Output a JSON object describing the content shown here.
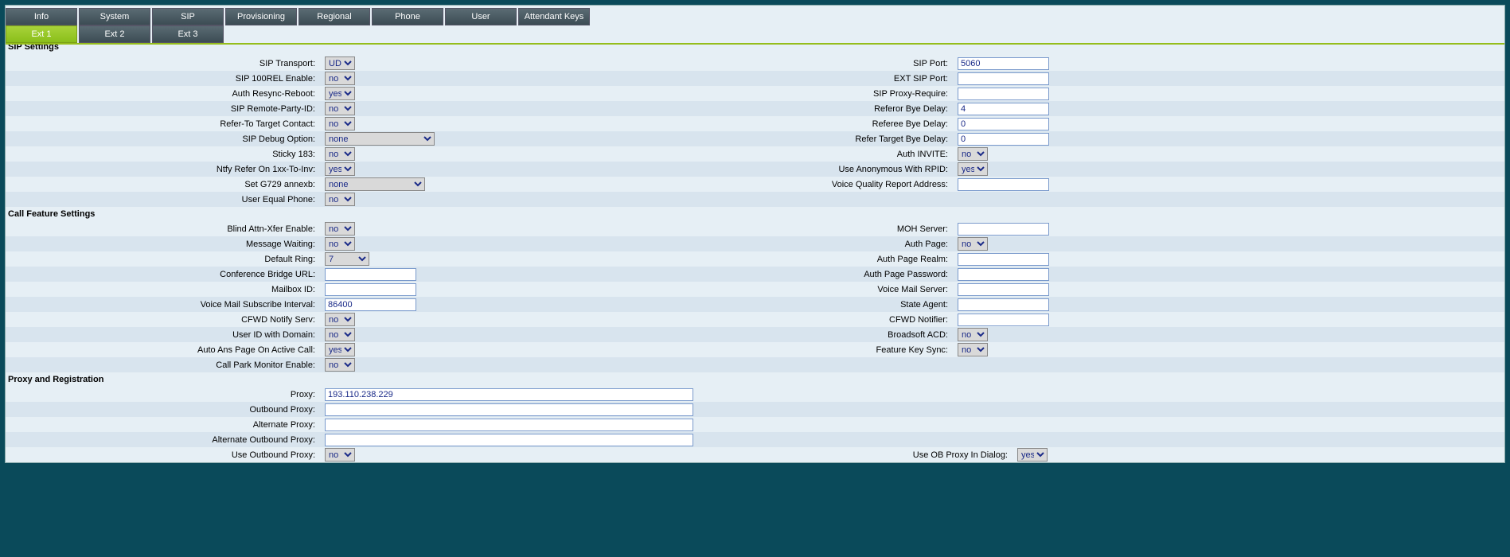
{
  "topTabs": [
    "Info",
    "System",
    "SIP",
    "Provisioning",
    "Regional",
    "Phone",
    "User",
    "Attendant Keys"
  ],
  "subTabs": [
    "Ext 1",
    "Ext 2",
    "Ext 3"
  ],
  "subActive": 0,
  "sections": {
    "sip": {
      "title": "SIP Settings",
      "rows": [
        {
          "l": "SIP Transport:",
          "t": "select",
          "v": "UDP",
          "w": "narrow",
          "r": "SIP Port:",
          "rt": "text",
          "rv": "5060"
        },
        {
          "l": "SIP 100REL Enable:",
          "t": "select",
          "v": "no",
          "w": "narrow",
          "r": "EXT SIP Port:",
          "rt": "text",
          "rv": ""
        },
        {
          "l": "Auth Resync-Reboot:",
          "t": "select",
          "v": "yes",
          "w": "narrow",
          "r": "SIP Proxy-Require:",
          "rt": "text",
          "rv": ""
        },
        {
          "l": "SIP Remote-Party-ID:",
          "t": "select",
          "v": "no",
          "w": "narrow",
          "r": "Referor Bye Delay:",
          "rt": "text",
          "rv": "4"
        },
        {
          "l": "Refer-To Target Contact:",
          "t": "select",
          "v": "no",
          "w": "narrow",
          "r": "Referee Bye Delay:",
          "rt": "text",
          "rv": "0"
        },
        {
          "l": "SIP Debug Option:",
          "t": "select",
          "v": "none",
          "w": "wide",
          "r": "Refer Target Bye Delay:",
          "rt": "text",
          "rv": "0"
        },
        {
          "l": "Sticky 183:",
          "t": "select",
          "v": "no",
          "w": "narrow",
          "r": "Auth INVITE:",
          "rt": "select",
          "rv": "no",
          "rw": "narrow"
        },
        {
          "l": "Ntfy Refer On 1xx-To-Inv:",
          "t": "select",
          "v": "yes",
          "w": "narrow",
          "r": "Use Anonymous With RPID:",
          "rt": "select",
          "rv": "yes",
          "rw": "narrow"
        },
        {
          "l": "Set G729 annexb:",
          "t": "select",
          "v": "none",
          "w": "wider",
          "r": "Voice Quality Report Address:",
          "rt": "text",
          "rv": ""
        },
        {
          "l": "User Equal Phone:",
          "t": "select",
          "v": "no",
          "w": "narrow"
        }
      ]
    },
    "cfs": {
      "title": "Call Feature Settings",
      "rows": [
        {
          "l": "Blind Attn-Xfer Enable:",
          "t": "select",
          "v": "no",
          "w": "narrow",
          "r": "MOH Server:",
          "rt": "text",
          "rv": ""
        },
        {
          "l": "Message Waiting:",
          "t": "select",
          "v": "no",
          "w": "narrow",
          "r": "Auth Page:",
          "rt": "select",
          "rv": "no",
          "rw": "narrow"
        },
        {
          "l": "Default Ring:",
          "t": "select",
          "v": "7",
          "w": "med",
          "r": "Auth Page Realm:",
          "rt": "text",
          "rv": ""
        },
        {
          "l": "Conference Bridge URL:",
          "t": "text",
          "v": "",
          "r": "Auth Page Password:",
          "rt": "text",
          "rv": ""
        },
        {
          "l": "Mailbox ID:",
          "t": "text",
          "v": "",
          "r": "Voice Mail Server:",
          "rt": "text",
          "rv": ""
        },
        {
          "l": "Voice Mail Subscribe Interval:",
          "t": "text",
          "v": "86400",
          "r": "State Agent:",
          "rt": "text",
          "rv": ""
        },
        {
          "l": "CFWD Notify Serv:",
          "t": "select",
          "v": "no",
          "w": "narrow",
          "r": "CFWD Notifier:",
          "rt": "text",
          "rv": ""
        },
        {
          "l": "User ID with Domain:",
          "t": "select",
          "v": "no",
          "w": "narrow",
          "r": "Broadsoft ACD:",
          "rt": "select",
          "rv": "no",
          "rw": "narrow"
        },
        {
          "l": "Auto Ans Page On Active Call:",
          "t": "select",
          "v": "yes",
          "w": "narrow",
          "r": "Feature Key Sync:",
          "rt": "select",
          "rv": "no",
          "rw": "narrow"
        },
        {
          "l": "Call Park Monitor Enable:",
          "t": "select",
          "v": "no",
          "w": "narrow"
        }
      ]
    },
    "proxy": {
      "title": "Proxy and Registration",
      "rows": [
        {
          "l": "Proxy:",
          "t": "text",
          "v": "193.110.238.229",
          "long": true
        },
        {
          "l": "Outbound Proxy:",
          "t": "text",
          "v": "",
          "long": true
        },
        {
          "l": "Alternate Proxy:",
          "t": "text",
          "v": "",
          "long": true
        },
        {
          "l": "Alternate Outbound Proxy:",
          "t": "text",
          "v": "",
          "long": true
        },
        {
          "l": "Use Outbound Proxy:",
          "t": "select",
          "v": "no",
          "w": "narrow",
          "r": "Use OB Proxy In Dialog:",
          "rt": "select",
          "rv": "yes",
          "rw": "narrow"
        }
      ]
    }
  }
}
